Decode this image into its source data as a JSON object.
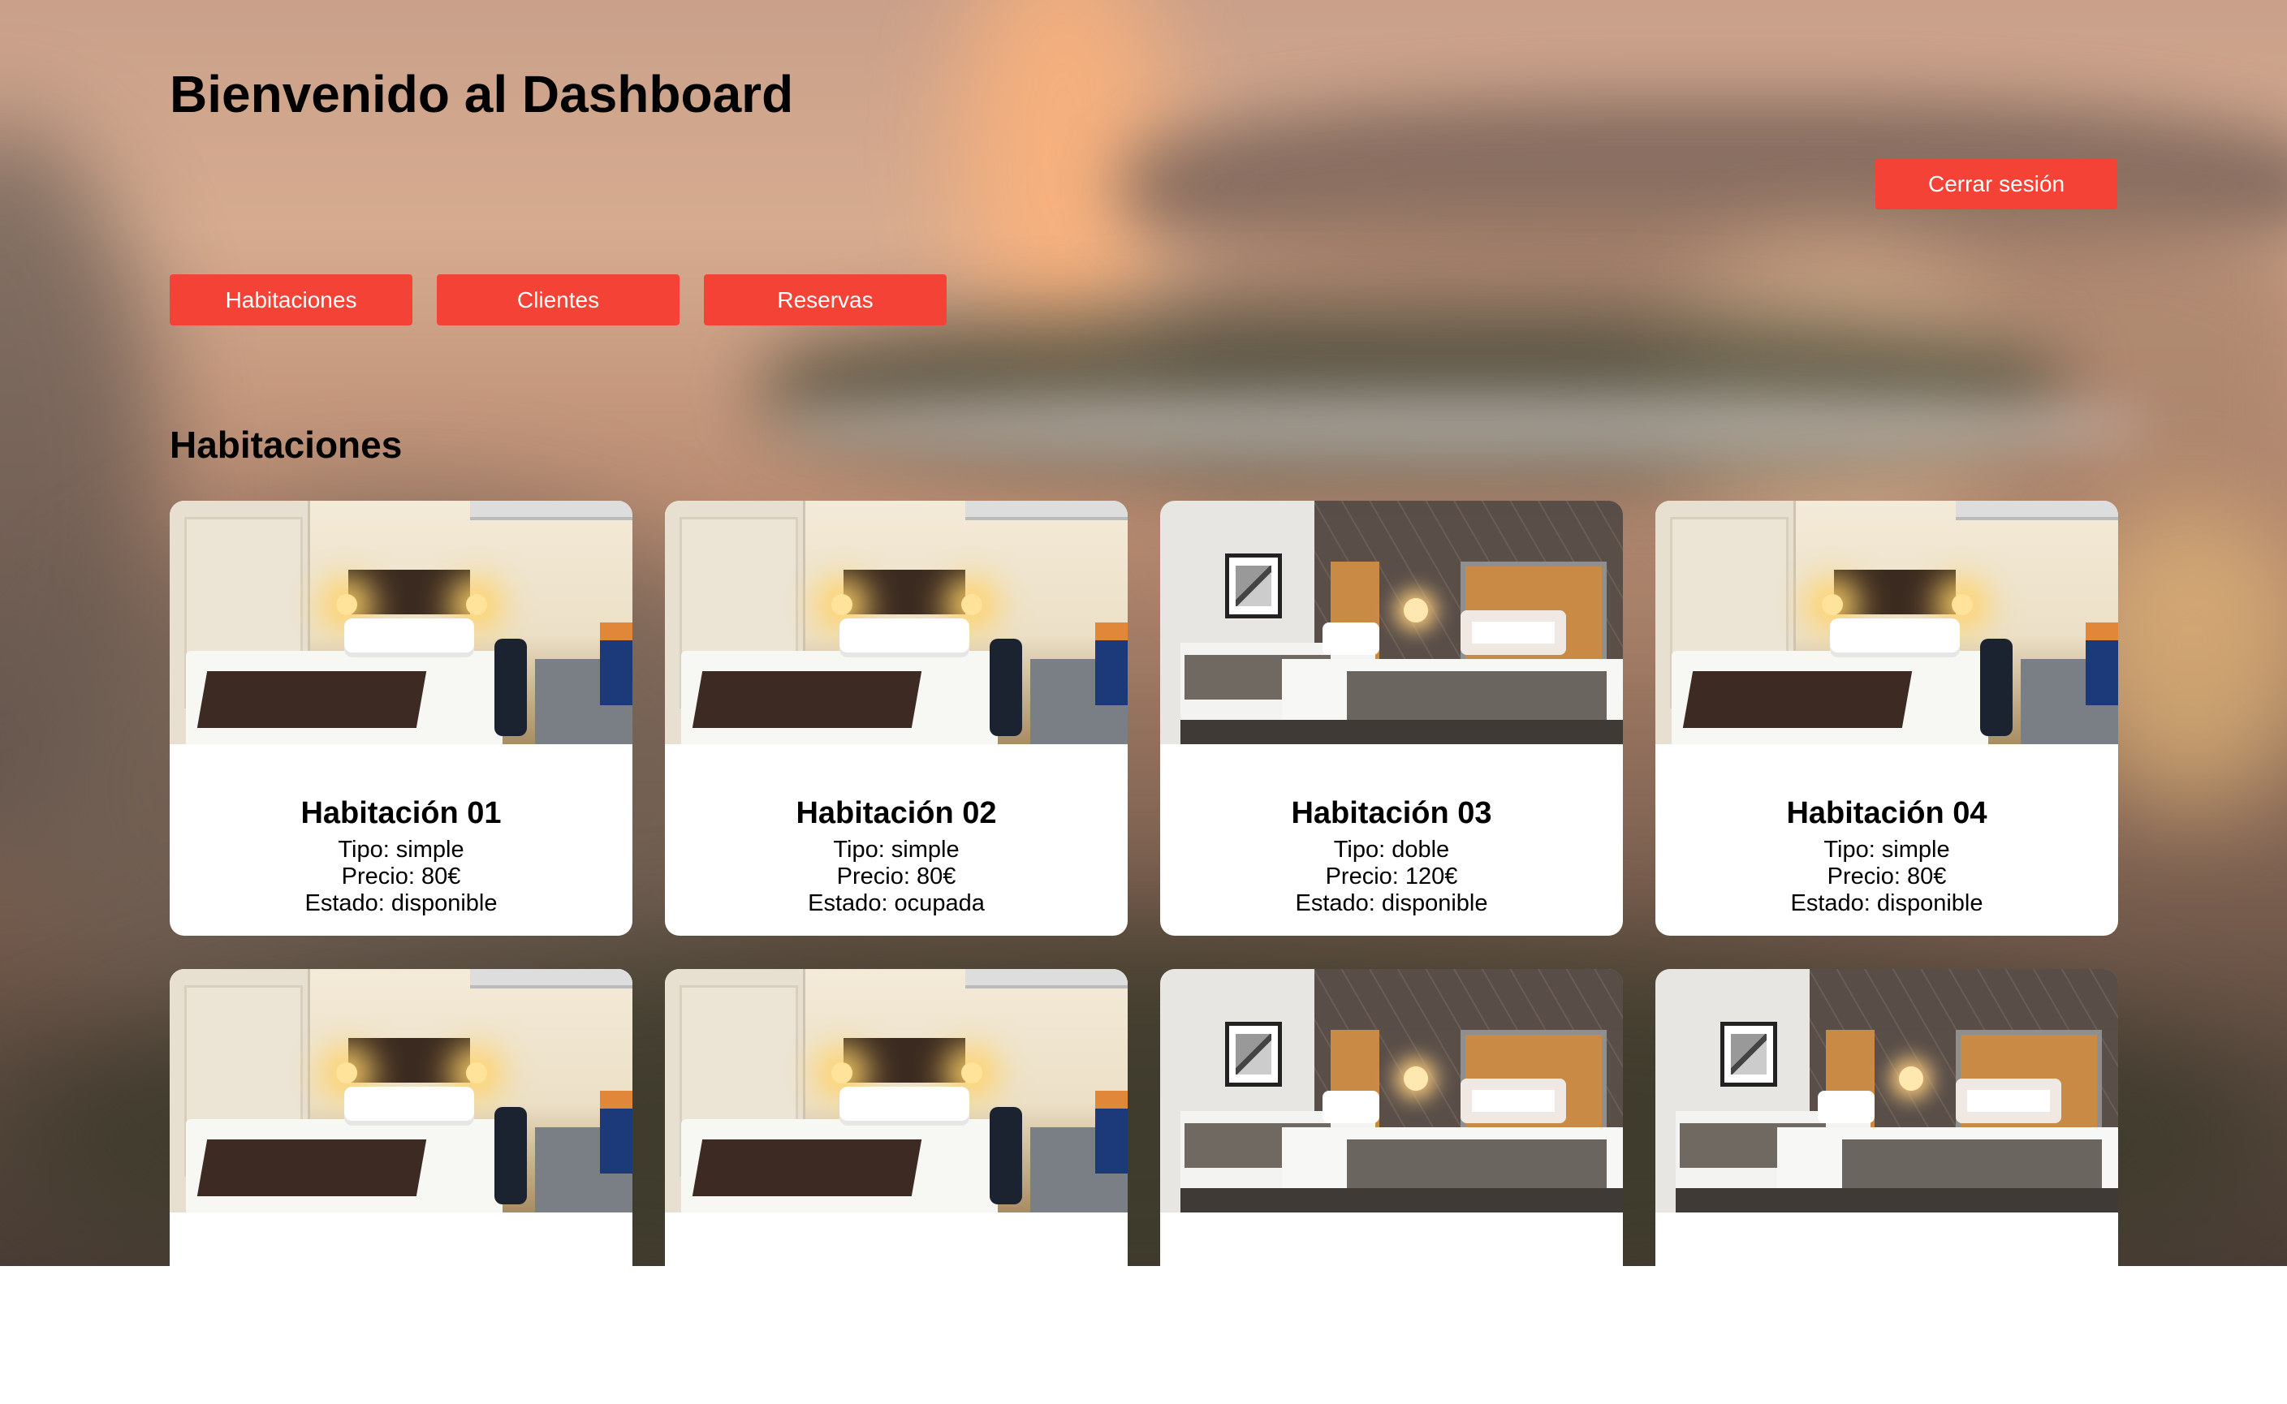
{
  "header": {
    "title": "Bienvenido al Dashboard",
    "logout_label": "Cerrar sesión"
  },
  "nav": {
    "items": [
      {
        "label": "Habitaciones"
      },
      {
        "label": "Clientes"
      },
      {
        "label": "Reservas"
      }
    ]
  },
  "section": {
    "title": "Habitaciones"
  },
  "rooms": [
    {
      "title": "Habitación 01",
      "tipo": "Tipo: simple",
      "precio": "Precio: 80€",
      "estado": "Estado: disponible",
      "photo": "room-single"
    },
    {
      "title": "Habitación 02",
      "tipo": "Tipo: simple",
      "precio": "Precio: 80€",
      "estado": "Estado: ocupada",
      "photo": "room-single"
    },
    {
      "title": "Habitación 03",
      "tipo": "Tipo: doble",
      "precio": "Precio: 120€",
      "estado": "Estado: disponible",
      "photo": "room-double"
    },
    {
      "title": "Habitación 04",
      "tipo": "Tipo: simple",
      "precio": "Precio: 80€",
      "estado": "Estado: disponible",
      "photo": "room-single"
    },
    {
      "photo": "room-single"
    },
    {
      "photo": "room-single"
    },
    {
      "photo": "room-double"
    },
    {
      "photo": "room-double"
    }
  ],
  "colors": {
    "accent": "#f44336",
    "card_bg": "#ffffff",
    "text": "#000000"
  }
}
